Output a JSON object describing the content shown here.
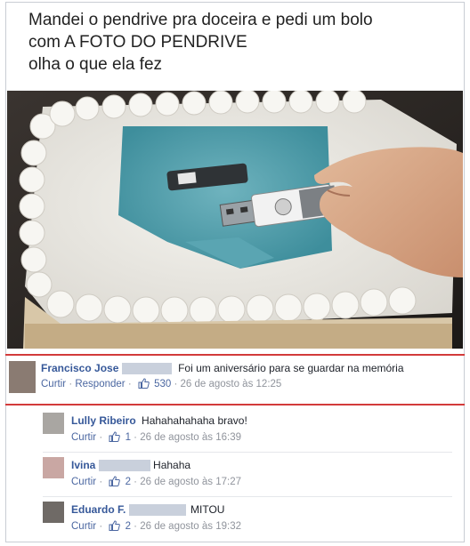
{
  "post": {
    "line1": "Mandei o pendrive pra doceira e pedi um bolo",
    "line2": "com A FOTO DO PENDRIVE",
    "line3": "olha o que ela fez"
  },
  "comments": [
    {
      "author": "Francisco Jose",
      "text": "Foi um aniversário para se guardar na memória",
      "like_label": "Curtir",
      "reply_label": "Responder",
      "likes": "530",
      "time": "26 de agosto às 12:25"
    },
    {
      "author": "Lully Ribeiro",
      "text": "Hahahahahaha bravo!",
      "like_label": "Curtir",
      "likes": "1",
      "time": "26 de agosto às 16:39"
    },
    {
      "author": "Ivina",
      "text": "Hahaha",
      "like_label": "Curtir",
      "likes": "2",
      "time": "26 de agosto às 17:27"
    },
    {
      "author": "Eduardo F.",
      "text": "MITOU",
      "like_label": "Curtir",
      "likes": "2",
      "time": "26 de agosto às 19:32"
    }
  ],
  "colors": {
    "link": "#365899",
    "meta": "#90949c",
    "highlight_rule": "#d23b3b"
  }
}
